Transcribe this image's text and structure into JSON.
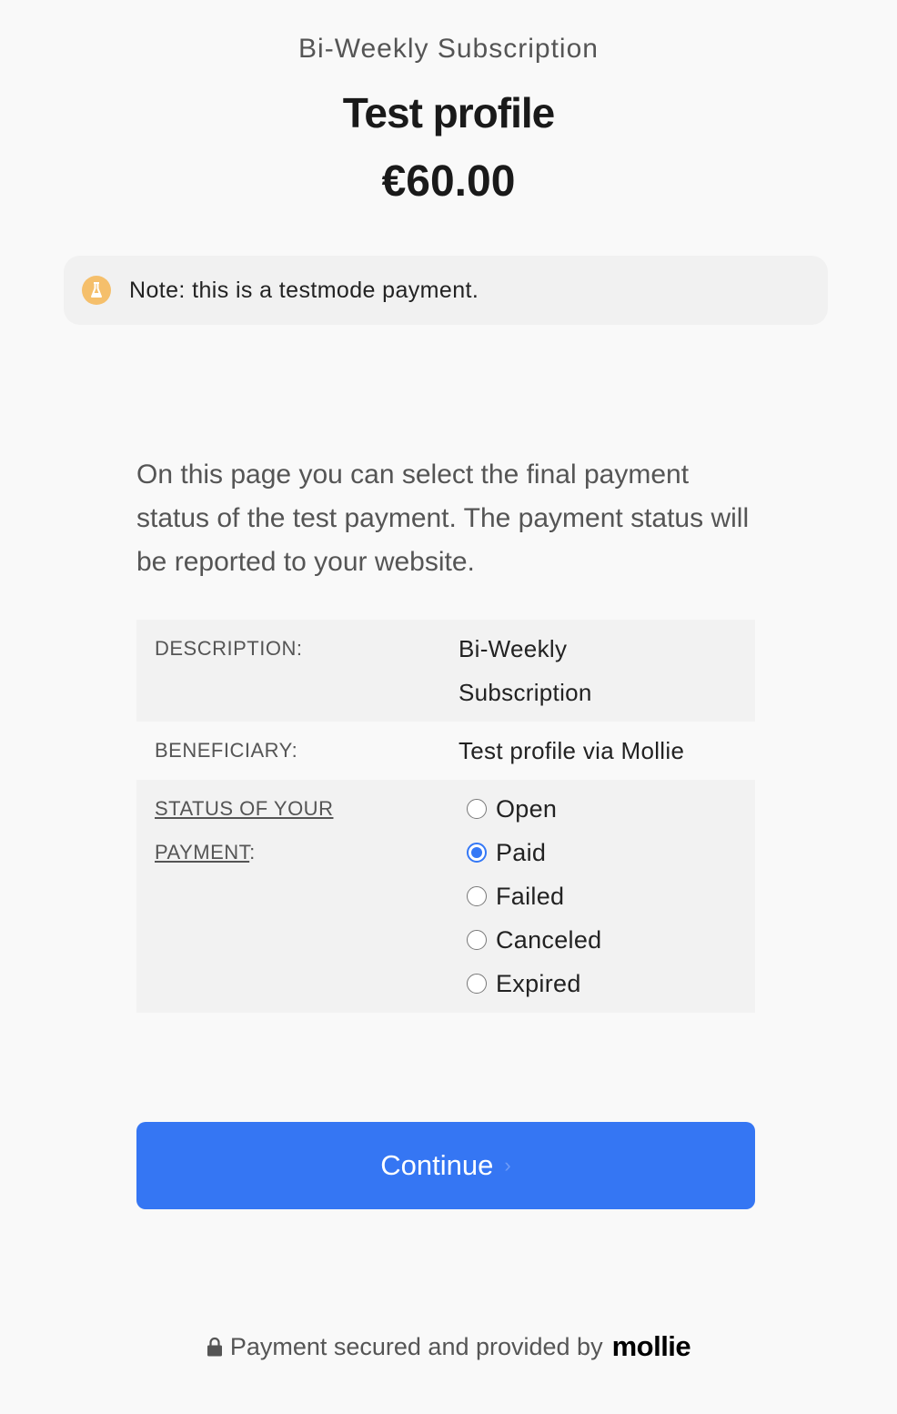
{
  "header": {
    "subtitle": "Bi-Weekly Subscription",
    "title": "Test profile",
    "amount": "€60.00"
  },
  "note": {
    "icon": "flask-icon",
    "text": "Note: this is a testmode payment."
  },
  "intro": "On this page you can select the final payment status of the test payment. The payment status will be reported to your website.",
  "details": {
    "description_label": "DESCRIPTION:",
    "description_value_line1": "Bi-Weekly",
    "description_value_line2": "Subscription",
    "beneficiary_label": "BENEFICIARY:",
    "beneficiary_value": "Test profile via Mollie",
    "status_label_line1": "STATUS OF YOUR",
    "status_label_line2": "PAYMENT",
    "status_label_colon": ":"
  },
  "status_options": [
    {
      "label": "Open",
      "checked": false
    },
    {
      "label": "Paid",
      "checked": true
    },
    {
      "label": "Failed",
      "checked": false
    },
    {
      "label": "Canceled",
      "checked": false
    },
    {
      "label": "Expired",
      "checked": false
    }
  ],
  "continue_button": {
    "label": "Continue",
    "chevron": "›"
  },
  "footer": {
    "text": "Payment secured and provided by",
    "brand": "mollie",
    "icon": "lock-icon"
  },
  "colors": {
    "accent": "#3576f3",
    "note_icon": "#f5bf6b",
    "background": "#f9f9f9"
  }
}
